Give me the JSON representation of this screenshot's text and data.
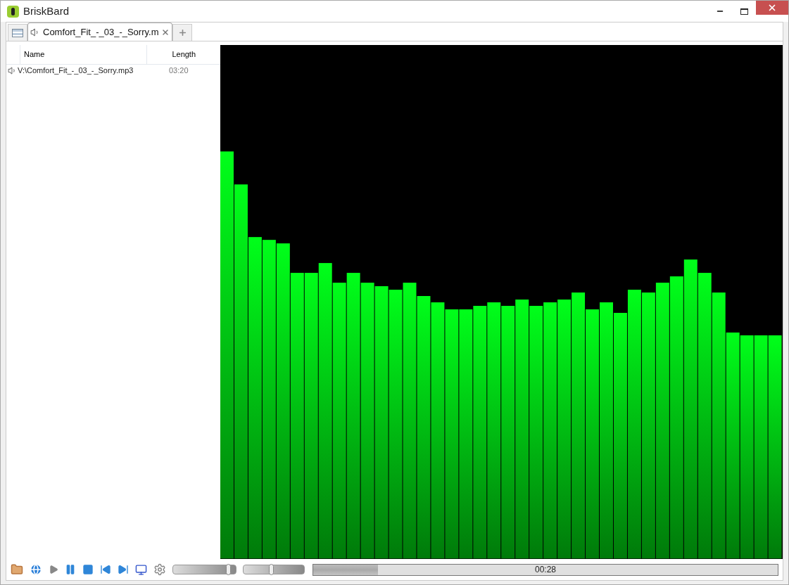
{
  "window": {
    "title": "BriskBard"
  },
  "tabs": [
    {
      "label": "Comfort_Fit_-_03_-_Sorry.m",
      "selected": true
    }
  ],
  "playlist": {
    "columns": [
      "Name",
      "Length"
    ],
    "rows": [
      {
        "name": "V:\\Comfort_Fit_-_03_-_Sorry.mp3",
        "length": "03:20",
        "playing": true
      }
    ]
  },
  "player": {
    "volume": {
      "level": 0.92
    },
    "balance": {
      "level": 0.5
    },
    "progress": {
      "level": 0.14,
      "time": "00:28"
    }
  }
}
